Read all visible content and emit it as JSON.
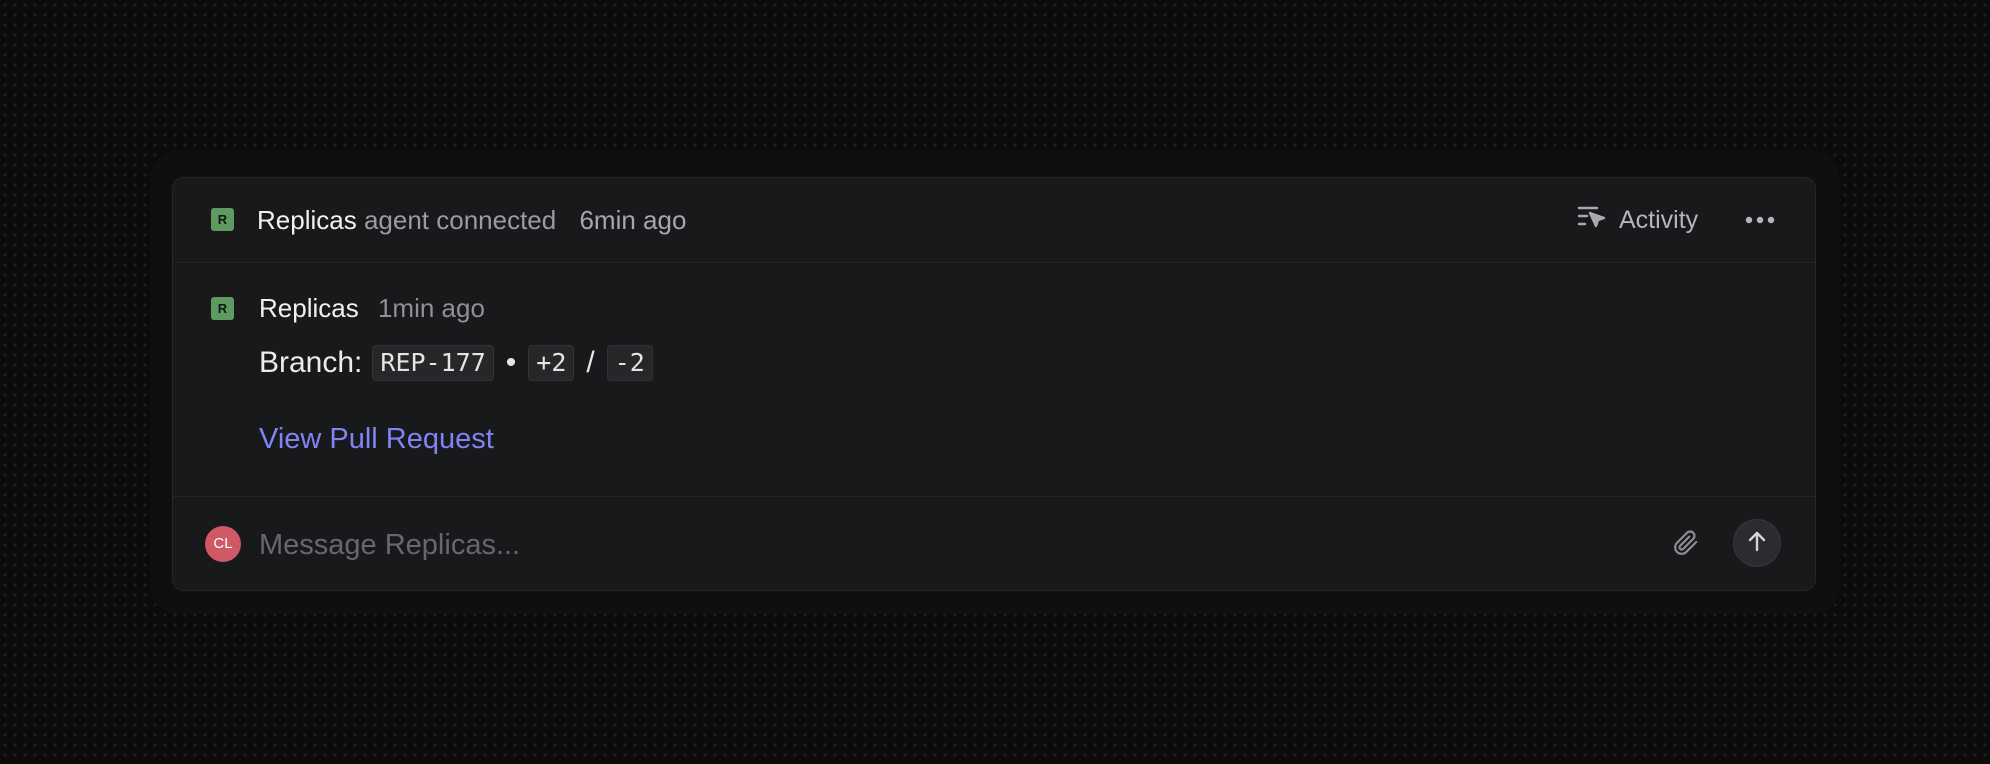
{
  "header": {
    "badge": "R",
    "agent_name": "Replicas",
    "status_text": "agent connected",
    "time": "6min ago",
    "activity_label": "Activity",
    "activity_icon": "activity-icon",
    "more_icon": "more-horizontal-icon"
  },
  "message": {
    "badge": "R",
    "author": "Replicas",
    "time": "1min ago",
    "branch_label": "Branch:",
    "branch_name": "REP-177",
    "bullet": "•",
    "additions": "+2",
    "slash": "/",
    "deletions": "-2",
    "link_label": "View Pull Request"
  },
  "composer": {
    "avatar_initials": "CL",
    "placeholder": "Message Replicas...",
    "attach_icon": "paperclip-icon",
    "send_icon": "arrow-up-icon"
  },
  "colors": {
    "background": "#0b0b0b",
    "card": "#18191b",
    "badge": "#5f9a61",
    "link": "#7f84f2",
    "avatar": "#cf5a66"
  }
}
